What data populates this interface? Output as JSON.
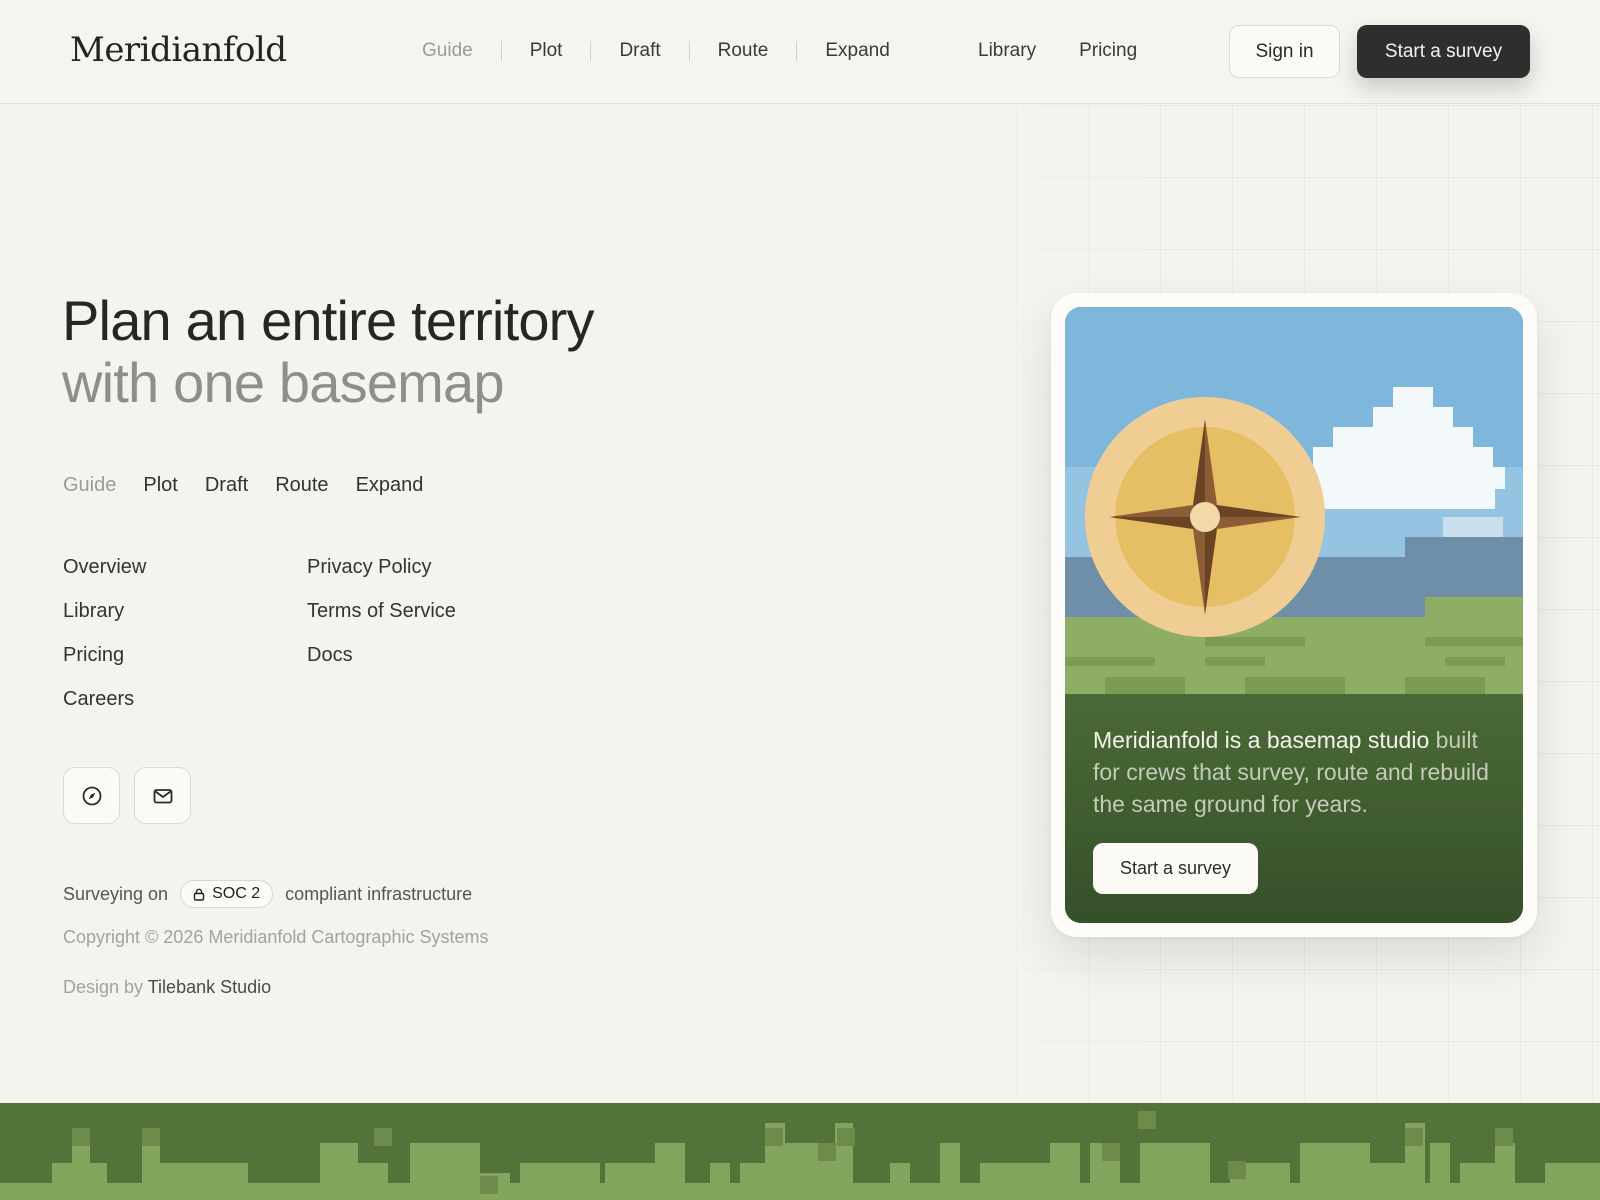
{
  "brand": {
    "name": "Meridianfold"
  },
  "header": {
    "primary_nav": [
      "Guide",
      "Plot",
      "Draft",
      "Route",
      "Expand"
    ],
    "secondary_nav": [
      "Library",
      "Pricing"
    ],
    "sign_in_label": "Sign in",
    "start_label": "Start a survey"
  },
  "hero": {
    "headline_line1": "Plan an entire territory",
    "headline_line2": "with one basemap",
    "steps": [
      "Guide",
      "Plot",
      "Draft",
      "Route",
      "Expand"
    ],
    "links_col_a": [
      "Overview",
      "Library",
      "Pricing",
      "Careers"
    ],
    "links_col_b": [
      "Privacy Policy",
      "Terms of Service",
      "Docs"
    ],
    "social_icons": [
      "compass-icon",
      "mail-icon"
    ],
    "trust_prefix": "Surveying on",
    "badge_label": "SOC 2",
    "trust_suffix": "compliant infrastructure",
    "copyright": "Copyright © 2026 Meridianfold Cartographic Systems",
    "credit_prefix": "Design by",
    "credit_studio": "Tilebank Studio"
  },
  "card": {
    "text_line1": "Meridianfold is a basemap studio",
    "text_line2": "built for crews that survey, route and rebuild the same ground for years.",
    "button_label": "Start a survey"
  },
  "colors": {
    "accent_dark": "#2d2e2e",
    "sky": "#7fb7dc",
    "grass": "#8fae65",
    "forest": "#54733a"
  }
}
